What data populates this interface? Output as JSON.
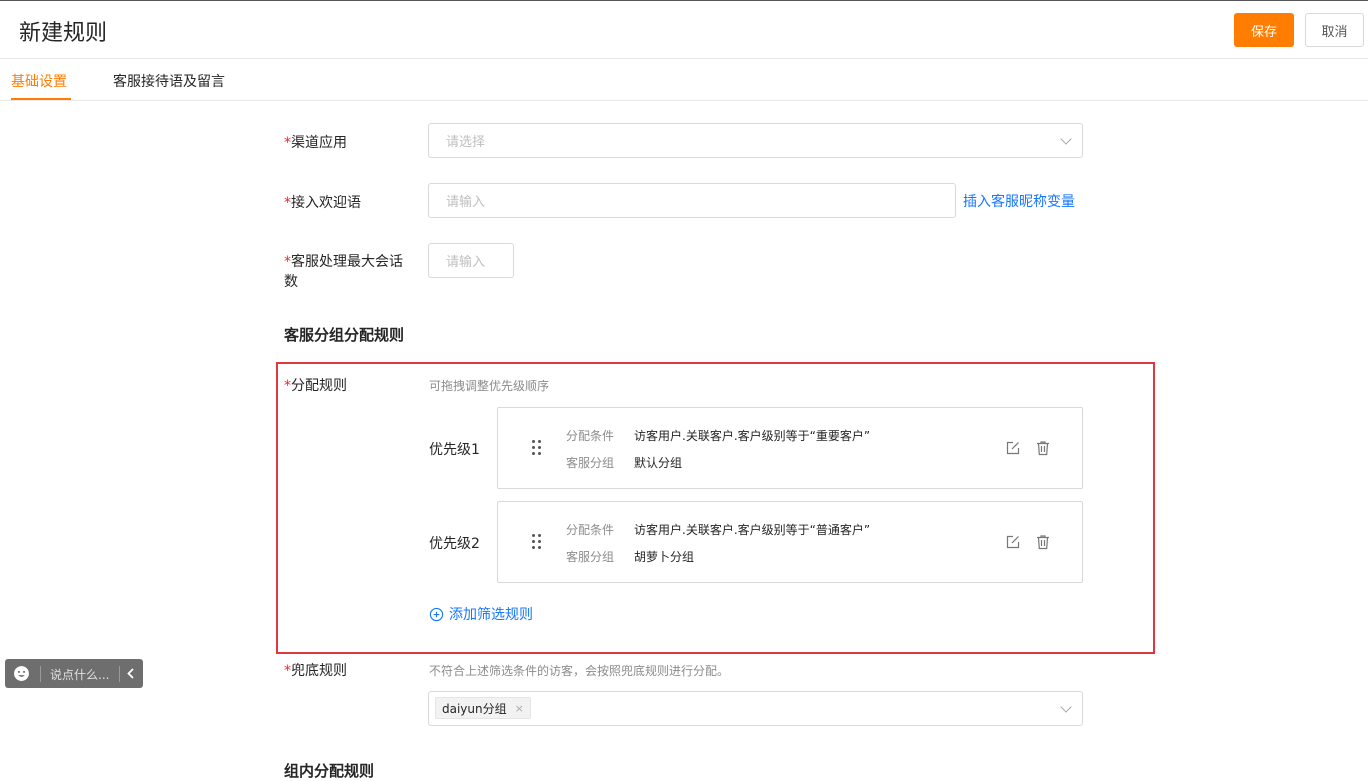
{
  "header": {
    "title": "新建规则",
    "save_label": "保存",
    "cancel_label": "取消"
  },
  "tabs": [
    {
      "label": "基础设置"
    },
    {
      "label": "客服接待语及留言"
    }
  ],
  "form": {
    "channel": {
      "label": "渠道应用",
      "placeholder": "请选择"
    },
    "welcome": {
      "label": "接入欢迎语",
      "placeholder": "请输入",
      "insert_link": "插入客服昵称变量"
    },
    "max_sessions": {
      "label_line1": "客服处理最大会话",
      "label_line2": "数",
      "placeholder": "请输入"
    }
  },
  "group_section": {
    "title": "客服分组分配规则",
    "rule_label": "分配规则",
    "rule_hint": "可拖拽调整优先级顺序",
    "priorities": [
      {
        "label": "优先级1",
        "cond_key": "分配条件",
        "cond_value": "访客用户.关联客户.客户级别等于“重要客户”",
        "group_key": "客服分组",
        "group_value": "默认分组"
      },
      {
        "label": "优先级2",
        "cond_key": "分配条件",
        "cond_value": "访客用户.关联客户.客户级别等于“普通客户”",
        "group_key": "客服分组",
        "group_value": "胡萝卜分组"
      }
    ],
    "add_rule": "添加筛选规则",
    "fallback_label": "兜底规则",
    "fallback_hint": "不符合上述筛选条件的访客，会按照兜底规则进行分配。",
    "fallback_tag": "daiyun分组"
  },
  "inner_section": {
    "title": "组内分配规则"
  },
  "chat_widget": {
    "placeholder": "说点什么..."
  },
  "icons": [
    "smile-icon",
    "chevron-left-icon",
    "drag-handle-icon",
    "edit-icon",
    "trash-icon",
    "plus-circle-icon",
    "chevron-down-icon",
    "close-icon"
  ],
  "colors": {
    "accent": "#ff7d00",
    "link": "#1677ff",
    "required": "#f5222d",
    "highlight_border": "#e0383e"
  }
}
